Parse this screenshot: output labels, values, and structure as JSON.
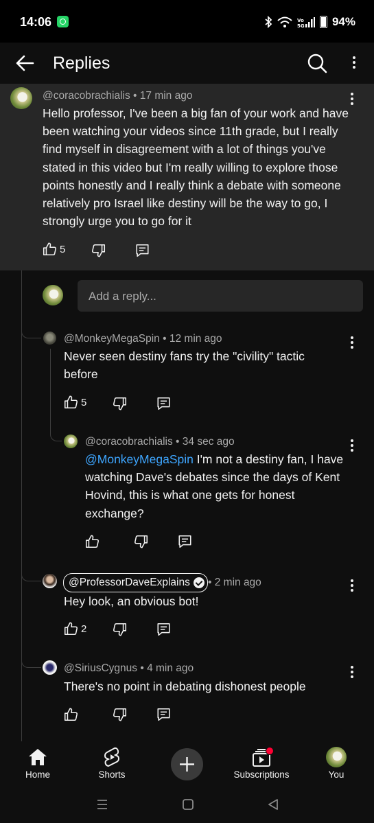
{
  "status_bar": {
    "time": "14:06",
    "battery": "94%"
  },
  "app_bar": {
    "title": "Replies"
  },
  "top_comment": {
    "author": "@coracobrachialis",
    "age": "• 17 min ago",
    "text": "Hello professor, I've been a big fan of your work and have been watching your videos since 11th grade, but I really find myself in disagreement with a lot of things you've stated in this video but I'm really willing to explore those points honestly and I really think a debate with someone relatively pro Israel like destiny will be the way to go, I strongly urge you to go for it",
    "likes": "5"
  },
  "reply_input": {
    "placeholder": "Add a reply..."
  },
  "replies": [
    {
      "author": "@MonkeyMegaSpin",
      "age": "• 12 min ago",
      "text": "Never seen destiny fans try the \"civility\" tactic before",
      "likes": "5"
    },
    {
      "author": "@coracobrachialis",
      "age": "• 34 sec ago",
      "mention": "@MonkeyMegaSpin",
      "text": " I'm not a destiny fan, I have watching Dave's debates since the days of Kent Hovind, this is what one gets for honest exchange?",
      "likes": ""
    },
    {
      "author": "@ProfessorDaveExplains",
      "age": "• 2 min ago",
      "text": "Hey look, an obvious bot!",
      "likes": "2"
    },
    {
      "author": "@SiriusCygnus",
      "age": "• 4 min ago",
      "text": "There's no point in debating dishonest people",
      "likes": ""
    }
  ],
  "bottom_nav": {
    "home": "Home",
    "shorts": "Shorts",
    "subscriptions": "Subscriptions",
    "you": "You"
  },
  "colors": {
    "accent_link": "#3ea6ff",
    "notification": "#ff0033",
    "background": "#0f0f0f",
    "surface": "#272727"
  }
}
